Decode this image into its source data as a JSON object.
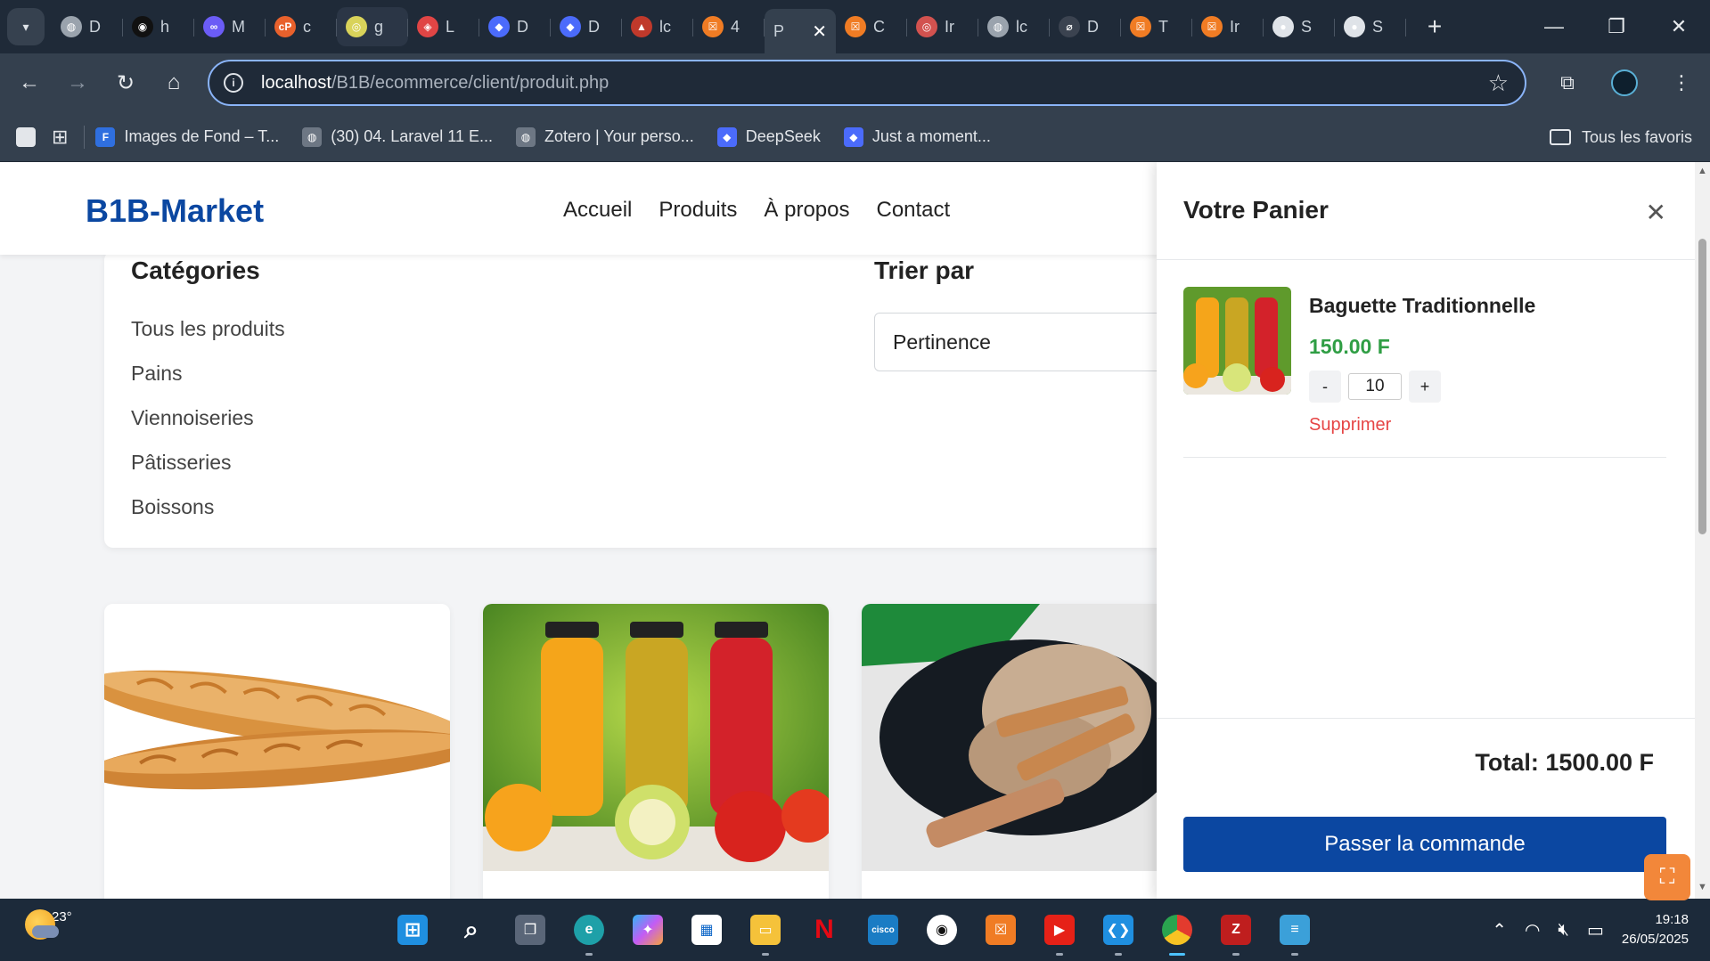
{
  "browser": {
    "tabs": [
      {
        "title": "D",
        "color": "#9aa3ad",
        "glyph": "◍"
      },
      {
        "title": "h",
        "color": "#111111",
        "glyph": "◉"
      },
      {
        "title": "M",
        "color": "#6b5cf6",
        "glyph": "∞"
      },
      {
        "title": "c",
        "color": "#e8612c",
        "glyph": "cP"
      },
      {
        "title": "g",
        "color": "#d9d35a",
        "glyph": "◎"
      },
      {
        "title": "L",
        "color": "#e04545",
        "glyph": "◈"
      },
      {
        "title": "D",
        "color": "#4b6bfb",
        "glyph": "◆"
      },
      {
        "title": "D",
        "color": "#4b6bfb",
        "glyph": "◆"
      },
      {
        "title": "lc",
        "color": "#c0392b",
        "glyph": "▲"
      },
      {
        "title": "4",
        "color": "#f07c24",
        "glyph": "☒"
      },
      {
        "title": "P",
        "color": "#34404e",
        "glyph": ""
      },
      {
        "title": "C",
        "color": "#f07c24",
        "glyph": "☒"
      },
      {
        "title": "Ir",
        "color": "#d2524f",
        "glyph": "◎"
      },
      {
        "title": "lc",
        "color": "#9aa3ad",
        "glyph": "◍"
      },
      {
        "title": "D",
        "color": "#3b4350",
        "glyph": "⌀"
      },
      {
        "title": "T",
        "color": "#f07c24",
        "glyph": "☒"
      },
      {
        "title": "Ir",
        "color": "#f07c24",
        "glyph": "☒"
      },
      {
        "title": "S",
        "color": "#dfe3e8",
        "glyph": "●"
      },
      {
        "title": "S",
        "color": "#dfe3e8",
        "glyph": "●"
      }
    ],
    "active_tab_index": 10,
    "url_host": "localhost",
    "url_path": "/B1B/ecommerce/client/produit.php",
    "bookmarks": [
      {
        "label": "Images de Fond – T...",
        "color": "#2f6fdf",
        "glyph": "F"
      },
      {
        "label": "(30) 04. Laravel 11 E...",
        "color": "#6d7784",
        "glyph": "◍"
      },
      {
        "label": "Zotero | Your perso...",
        "color": "#6d7784",
        "glyph": "◍"
      },
      {
        "label": "DeepSeek",
        "color": "#4b6bfb",
        "glyph": "◆"
      },
      {
        "label": "Just a moment...",
        "color": "#4b6bfb",
        "glyph": "◆"
      }
    ],
    "all_bookmarks": "Tous les favoris"
  },
  "site": {
    "brand": "B1B-Market",
    "brand_color": "#0b47a1",
    "nav": [
      "Accueil",
      "Produits",
      "À propos",
      "Contact"
    ]
  },
  "filters": {
    "categories_title": "Catégories",
    "categories": [
      "Tous les produits",
      "Pains",
      "Viennoiseries",
      "Pâtisseries",
      "Boissons"
    ],
    "sort_title": "Trier par",
    "sort_value": "Pertinence"
  },
  "cart": {
    "title": "Votre Panier",
    "item_name": "Baguette Traditionnelle",
    "item_price": "150.00 F",
    "qty_minus": "-",
    "qty_value": "10",
    "qty_plus": "+",
    "remove_label": "Supprimer",
    "total": "Total: 1500.00 F",
    "checkout_label": "Passer la commande",
    "price_color": "#2f9e44",
    "remove_color": "#e64545"
  },
  "taskbar": {
    "temperature": "23°",
    "time": "19:18",
    "date": "26/05/2025"
  }
}
